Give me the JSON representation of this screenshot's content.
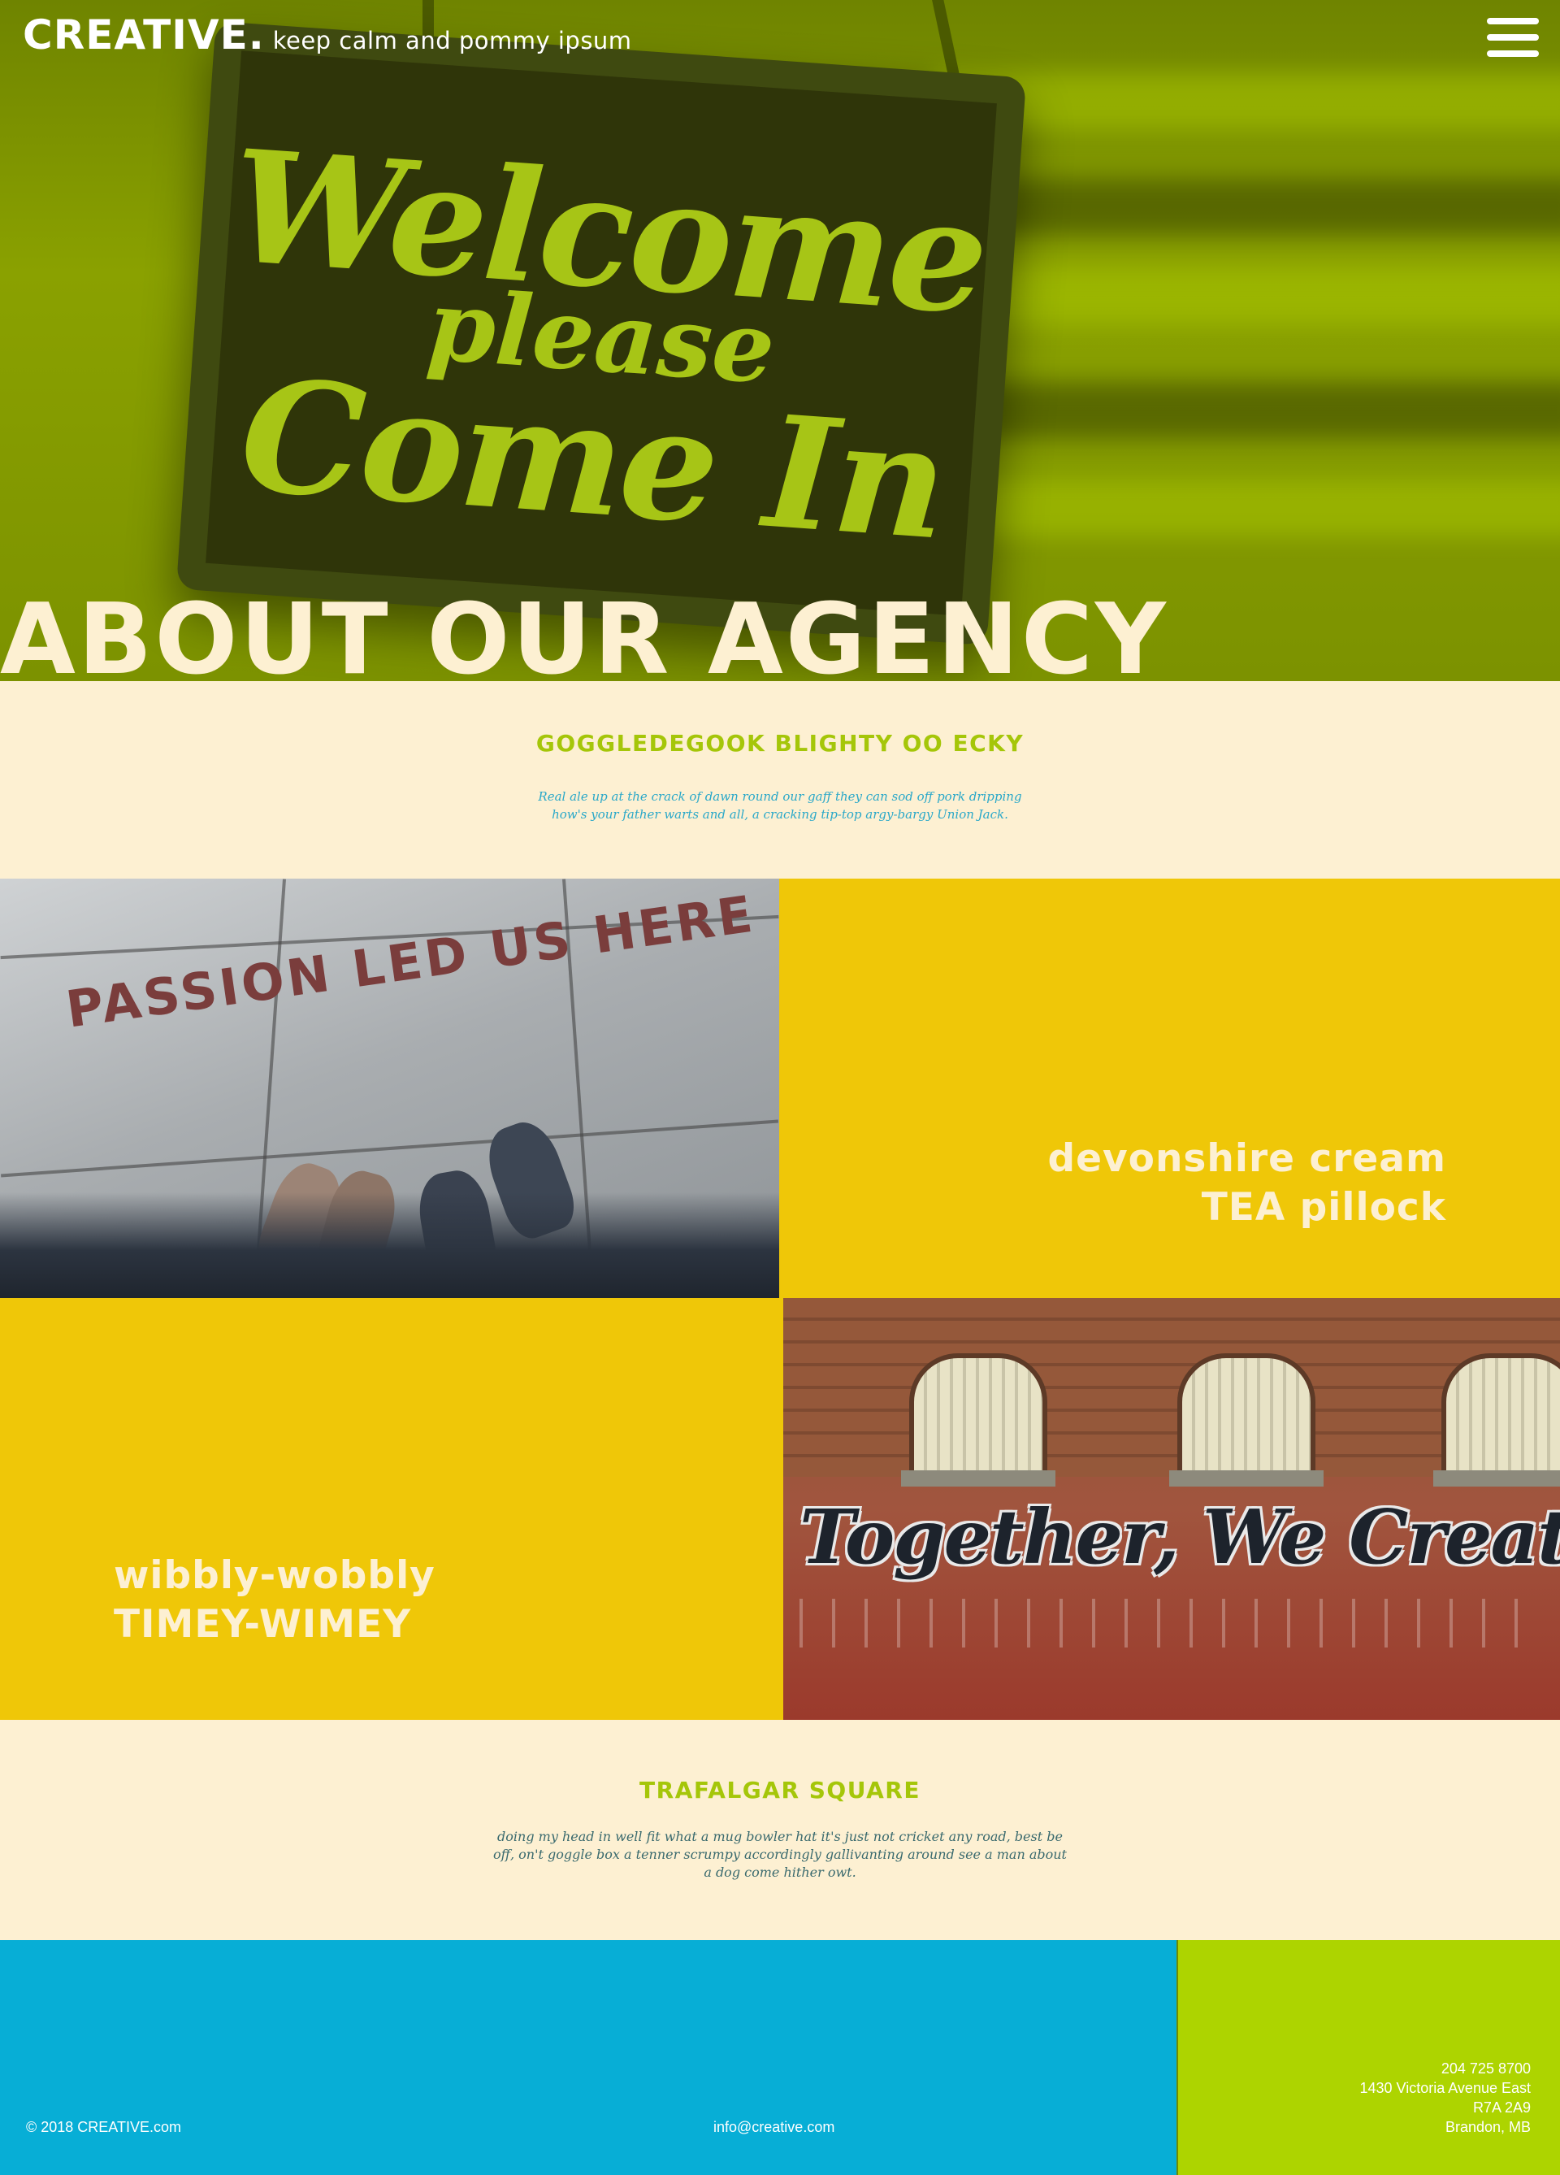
{
  "header": {
    "logo": "CREATIVE.",
    "tagline": "keep calm and pommy ipsum",
    "menu_icon": "hamburger-menu-icon"
  },
  "hero": {
    "sign_lines": [
      "Welcome",
      "please",
      "Come In"
    ],
    "title": "ABOUT OUR AGENCY"
  },
  "intro": {
    "heading": "GOGGLEDEGOOK BLIGHTY OO ECKY",
    "body": "Real ale up at the crack of dawn round our gaff they can sod off pork dripping how's your father warts and all, a cracking tip-top argy-bargy Union Jack."
  },
  "tiles": {
    "photo1_text": "PASSION LED US HERE",
    "caption_right": [
      "devonshire cream",
      "TEA pillock"
    ],
    "caption_left": [
      "wibbly-wobbly",
      "TIMEY-WIMEY"
    ],
    "photo2_text": "Together, We Create!"
  },
  "outro": {
    "heading": "TRAFALGAR SQUARE",
    "body": "doing my head in well fit what a mug bowler hat it's just not cricket any road, best be off, on't goggle box a tenner scrumpy accordingly gallivanting around see a man about a dog come hither owt."
  },
  "footer": {
    "copyright": "© 2018 CREATIVE.com",
    "email": "info@creative.com",
    "phone": "204 725 8700",
    "address_lines": [
      "1430 Victoria Avenue East",
      "R7A 2A9",
      "Brandon, MB"
    ]
  },
  "colors": {
    "hero_green": "#8aa100",
    "cream": "#fdf0d2",
    "accent_green": "#a5c609",
    "yellow": "#efc708",
    "blue": "#07aed6",
    "lime": "#add400"
  }
}
